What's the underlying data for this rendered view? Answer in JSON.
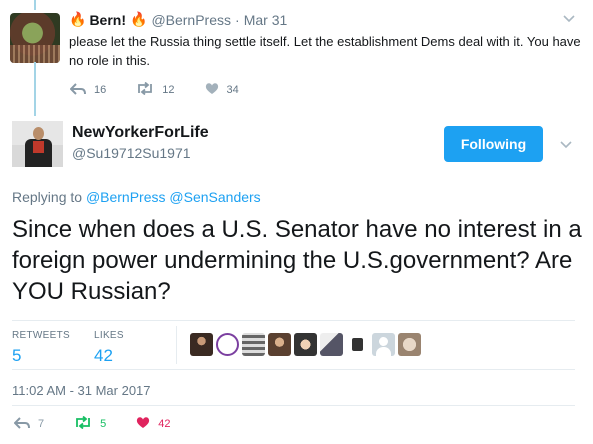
{
  "parent_tweet": {
    "name": "Bern!",
    "handle": "@BernPress",
    "separator": "·",
    "date": "Mar 31",
    "text": "please let the Russia thing settle itself. Let the establishment Dems deal with it. You have no role in this.",
    "replies": "16",
    "retweets": "12",
    "likes": "34",
    "icons": [
      "fire-icon",
      "fire-icon",
      "reply-icon",
      "retweet-icon",
      "heart-icon",
      "chevron-down-icon"
    ]
  },
  "main_tweet": {
    "name": "NewYorkerForLife",
    "handle": "@Su19712Su1971",
    "follow_label": "Following",
    "replying_prefix": "Replying to",
    "replying_to": [
      "@BernPress",
      "@SenSanders"
    ],
    "text": "Since when does a U.S. Senator have no interest in a foreign power undermining the U.S.government? Are YOU Russian?",
    "stats": {
      "retweets_label": "RETWEETS",
      "retweets_value": "5",
      "likes_label": "LIKES",
      "likes_value": "42"
    },
    "timestamp": "11:02 AM - 31 Mar 2017",
    "actions": {
      "replies": "7",
      "retweets": "5",
      "likes": "42"
    },
    "accent_color": "#1da1f2",
    "retweet_color": "#17bf63",
    "like_color": "#e0245e"
  }
}
